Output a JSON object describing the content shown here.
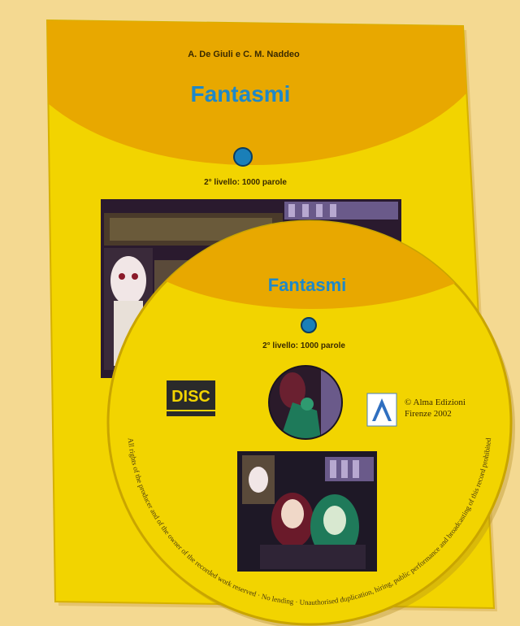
{
  "book": {
    "authors": "A. De Giuli e C. M. Naddeo",
    "title": "Fantasmi",
    "level": "2° livello: 1000 parole"
  },
  "cd": {
    "title": "Fantasmi",
    "level": "2° livello: 1000 parole",
    "publisher_line1": "© Alma Edizioni",
    "publisher_line2": "Firenze 2002",
    "disc_logo": "DISC",
    "rim_text": "All rights of the producer and of the owner of the recorded work reserved · No lending · Unauthorised duplication, hiring, public performance and broadcasting of this record prohibited"
  },
  "colors": {
    "background": "#f4d991",
    "cover_yellow": "#f2d400",
    "cover_orange": "#e8a800",
    "title_blue": "#1e88c8",
    "dot_blue": "#1a7fb8"
  }
}
